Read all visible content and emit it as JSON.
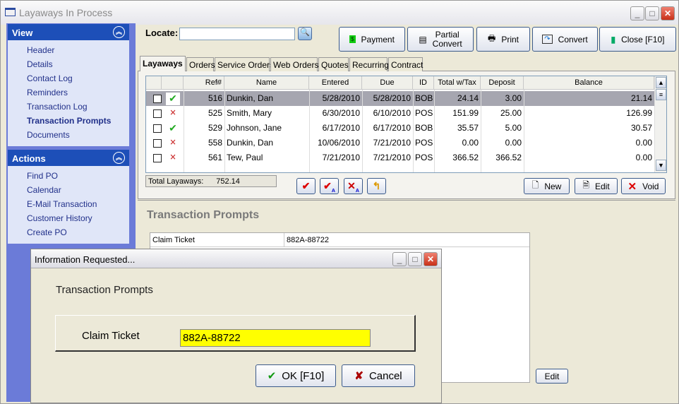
{
  "window": {
    "title": "Layaways In Process"
  },
  "sidebar": {
    "view": {
      "title": "View",
      "items": [
        "Header",
        "Details",
        "Contact Log",
        "Reminders",
        "Transaction Log",
        "Transaction Prompts",
        "Documents"
      ],
      "active": "Transaction Prompts"
    },
    "actions": {
      "title": "Actions",
      "items": [
        "Find PO",
        "Calendar",
        "E-Mail Transaction",
        "Customer History",
        "Create PO"
      ]
    }
  },
  "locate": {
    "label": "Locate:",
    "value": ""
  },
  "toolbar": {
    "payment": "Payment",
    "partial_convert_1": "Partial",
    "partial_convert_2": "Convert",
    "print": "Print",
    "convert": "Convert",
    "close": "Close [F10]"
  },
  "tabs": [
    "Layaways",
    "Orders",
    "Service Orders",
    "Web Orders",
    "Quotes",
    "Recurring",
    "Contract"
  ],
  "grid": {
    "columns": [
      "Ref#",
      "Name",
      "Entered",
      "Due",
      "ID",
      "Total w/Tax",
      "Deposit",
      "Balance"
    ],
    "rows": [
      {
        "status": "check",
        "ref": "516",
        "name": "Dunkin, Dan",
        "entered": "5/28/2010",
        "due": "5/28/2010",
        "id": "BOB",
        "total": "24.14",
        "deposit": "3.00",
        "balance": "21.14",
        "selected": true
      },
      {
        "status": "doc-x",
        "ref": "525",
        "name": "Smith, Mary",
        "entered": "6/30/2010",
        "due": "6/10/2010",
        "id": "POS",
        "total": "151.99",
        "deposit": "25.00",
        "balance": "126.99"
      },
      {
        "status": "check",
        "ref": "529",
        "name": "Johnson, Jane",
        "entered": "6/17/2010",
        "due": "6/17/2010",
        "id": "BOB",
        "total": "35.57",
        "deposit": "5.00",
        "balance": "30.57"
      },
      {
        "status": "doc-x",
        "ref": "558",
        "name": "Dunkin, Dan",
        "entered": "10/06/2010",
        "due": "7/21/2010",
        "id": "POS",
        "total": "0.00",
        "deposit": "0.00",
        "balance": "0.00"
      },
      {
        "status": "doc-x",
        "ref": "561",
        "name": "Tew, Paul",
        "entered": "7/21/2010",
        "due": "7/21/2010",
        "id": "POS",
        "total": "366.52",
        "deposit": "366.52",
        "balance": "0.00"
      }
    ]
  },
  "totals": {
    "label": "Total Layaways:",
    "value": "752.14"
  },
  "grid_buttons": {
    "new": "New",
    "edit": "Edit",
    "void": "Void"
  },
  "prompts": {
    "title": "Transaction Prompts",
    "rows": [
      {
        "label": "Claim Ticket",
        "value": "882A-88722"
      }
    ],
    "edit": "Edit"
  },
  "dialog": {
    "title": "Information Requested...",
    "heading": "Transaction Prompts",
    "field_label": "Claim Ticket",
    "field_value": "882A-88722",
    "ok": "OK [F10]",
    "cancel": "Cancel",
    "field_color": "#ffff00"
  }
}
